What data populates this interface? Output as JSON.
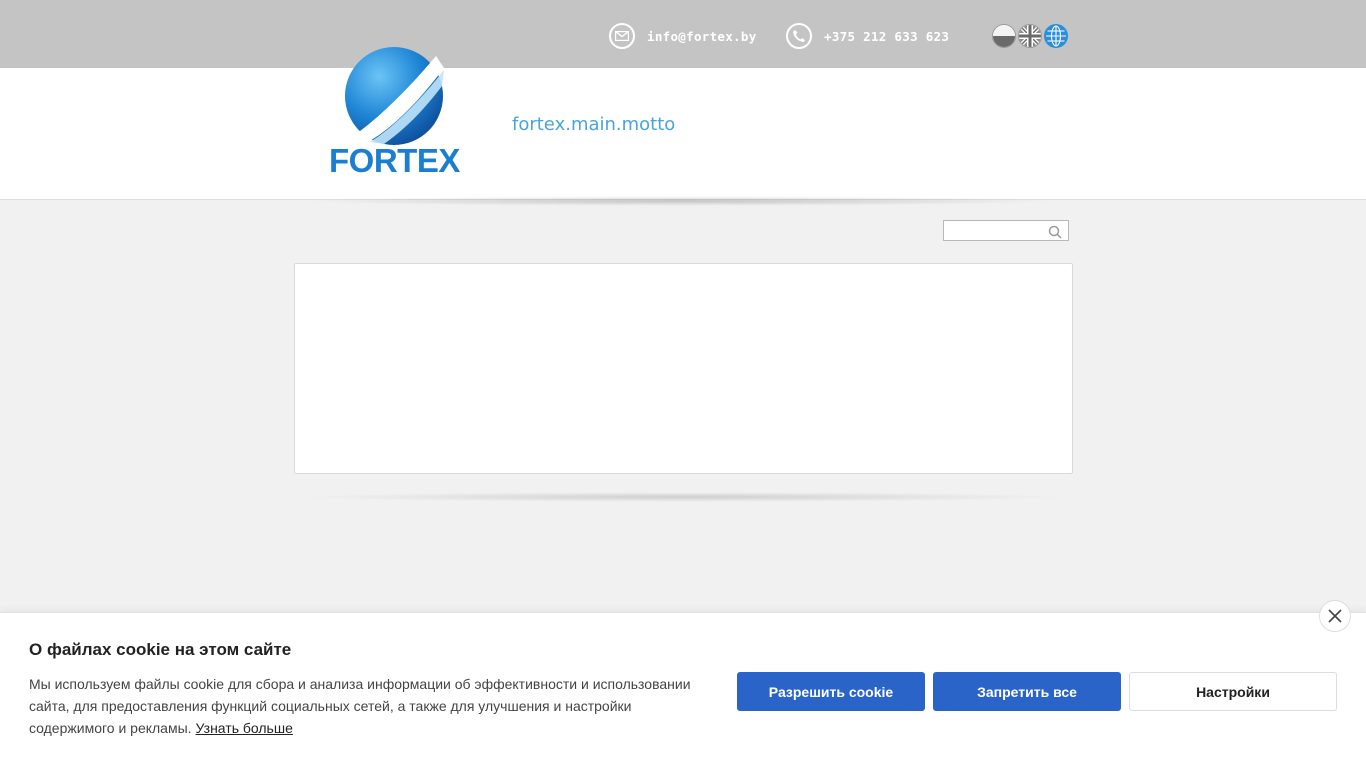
{
  "topbar": {
    "email": "info@fortex.by",
    "phone": "+375 212 633 623",
    "languages": [
      {
        "code": "ru",
        "icon": "russia-flag-icon"
      },
      {
        "code": "en",
        "icon": "uk-flag-icon"
      },
      {
        "code": "world",
        "icon": "globe-icon"
      }
    ]
  },
  "header": {
    "logo_text": "FORTEX",
    "motto": "fortex.main.motto"
  },
  "search": {
    "value": "",
    "placeholder": ""
  },
  "cookie": {
    "title": "О файлах cookie на этом сайте",
    "text": "Мы используем файлы cookie для сбора и анализа информации об эффективности и использовании сайта, для предоставления функций социальных сетей, а также для улучшения и настройки содержимого и рекламы.",
    "learn_more": "Узнать больше",
    "allow_label": "Разрешить cookie",
    "deny_label": "Запретить все",
    "settings_label": "Настройки"
  },
  "colors": {
    "topbar": "#c4c4c4",
    "brand_blue": "#1b7fd1",
    "motto": "#4aa3db",
    "primary_button": "#2b64c8"
  }
}
